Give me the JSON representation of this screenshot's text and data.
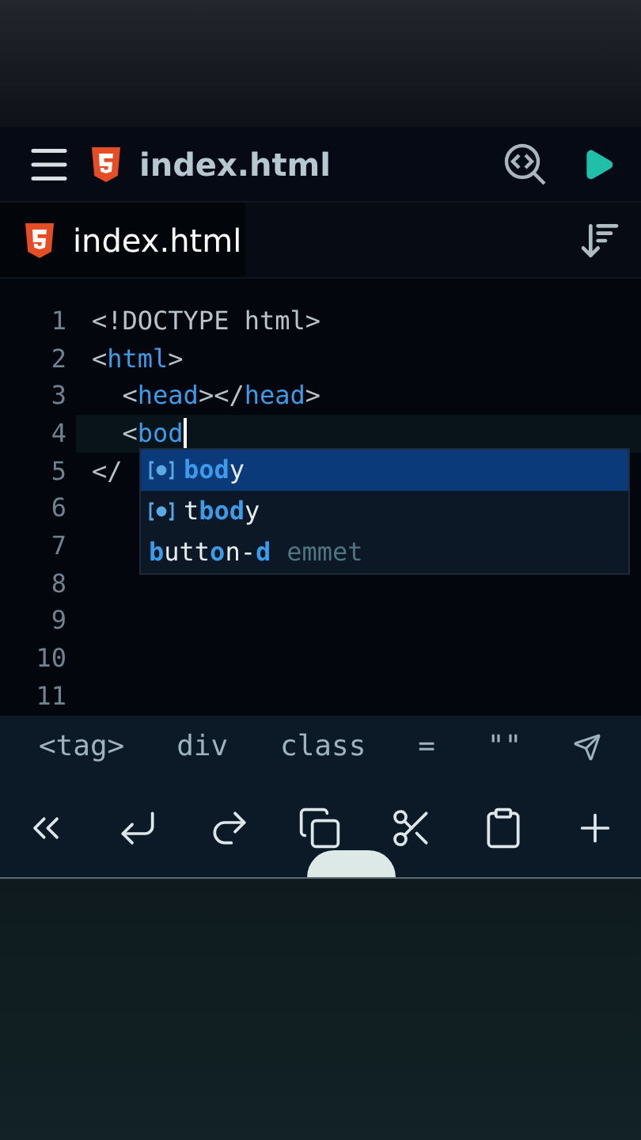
{
  "app_bar": {
    "title": "index.html"
  },
  "tabs": [
    {
      "label": "index.html",
      "selected": true
    }
  ],
  "editor": {
    "lines": [
      {
        "number": "1",
        "current": false,
        "tokens": [
          {
            "kind": "punct",
            "text": "<!DOCTYPE html>"
          }
        ]
      },
      {
        "number": "2",
        "current": false,
        "tokens": [
          {
            "kind": "punct",
            "text": "<"
          },
          {
            "kind": "tag",
            "text": "html"
          },
          {
            "kind": "punct",
            "text": ">"
          }
        ]
      },
      {
        "number": "3",
        "current": false,
        "tokens": [
          {
            "kind": "punct",
            "text": "  <"
          },
          {
            "kind": "tag",
            "text": "head"
          },
          {
            "kind": "punct",
            "text": "></"
          },
          {
            "kind": "tag",
            "text": "head"
          },
          {
            "kind": "punct",
            "text": ">"
          }
        ]
      },
      {
        "number": "4",
        "current": true,
        "cursor": true,
        "tokens": [
          {
            "kind": "punct",
            "text": "  <"
          },
          {
            "kind": "tag",
            "text": "bod"
          }
        ]
      },
      {
        "number": "5",
        "current": false,
        "tokens": [
          {
            "kind": "punct",
            "text": "</"
          }
        ]
      },
      {
        "number": "6",
        "current": false
      },
      {
        "number": "7",
        "current": false
      },
      {
        "number": "8",
        "current": false
      },
      {
        "number": "9",
        "current": false
      },
      {
        "number": "10",
        "current": false
      },
      {
        "number": "11",
        "current": false
      }
    ]
  },
  "suggestions": [
    {
      "kind": "element",
      "selected": true,
      "parts": [
        {
          "text": "bod",
          "match": true
        },
        {
          "text": "y",
          "match": false
        }
      ]
    },
    {
      "kind": "element",
      "selected": false,
      "parts": [
        {
          "text": "t",
          "match": false
        },
        {
          "text": "bod",
          "match": true
        },
        {
          "text": "y",
          "match": false
        }
      ]
    },
    {
      "kind": "snippet",
      "selected": false,
      "parts": [
        {
          "text": "b",
          "match": true
        },
        {
          "text": "utt",
          "match": false
        },
        {
          "text": "o",
          "match": true
        },
        {
          "text": "n-",
          "match": false
        },
        {
          "text": "d",
          "match": true
        }
      ],
      "detail": "emmet"
    }
  ],
  "symbols": [
    "<tag>",
    "div",
    "class",
    "=",
    "\"\""
  ]
}
